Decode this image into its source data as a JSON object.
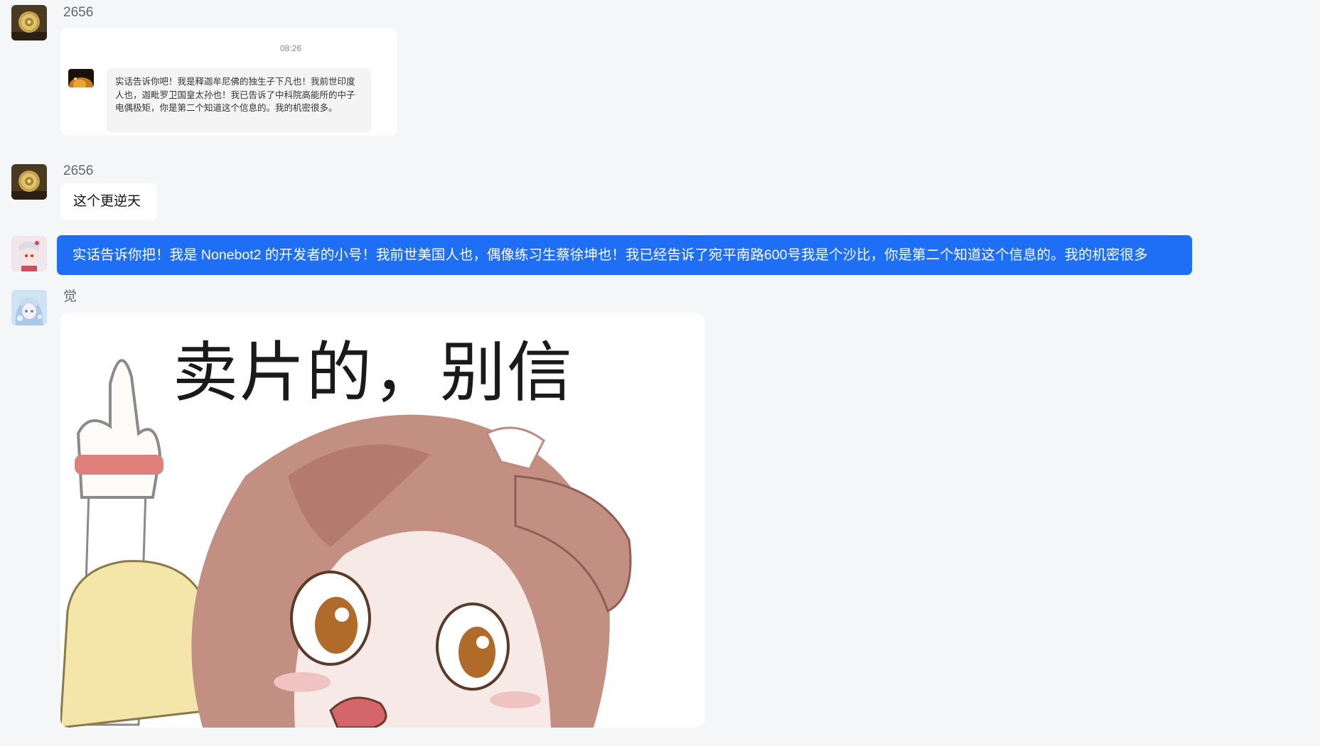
{
  "messages": [
    {
      "sender": "2656",
      "avatar_icon": "golden-coin-avatar-icon",
      "type": "forwarded-card",
      "forward": {
        "time": "08:26",
        "avatar_icon": "dark-orange-avatar-icon",
        "text": "实话告诉你吧！我是释迦牟尼佛的独生子下凡也！我前世印度人也，迦毗罗卫国皇太孙也！我已告诉了中科院高能所的中子电偶极矩，你是第二个知道这个信息的。我的机密很多。"
      }
    },
    {
      "sender": "2656",
      "avatar_icon": "golden-coin-avatar-icon",
      "type": "text",
      "text": "这个更逆天"
    },
    {
      "sender": "",
      "avatar_icon": "anime-girl-avatar-icon",
      "type": "self-text",
      "text": "实话告诉你把！我是 Nonebot2 的开发者的小号！我前世美国人也，偶像练习生蔡徐坤也！我已经告诉了宛平南路600号我是个沙比，你是第二个知道这个信息的。我的机密很多"
    },
    {
      "sender": "觉",
      "avatar_icon": "blue-anime-avatar-icon",
      "type": "image",
      "image": {
        "caption": "卖片的，别信",
        "icon": "anime-girl-middle-finger-meme-icon"
      }
    }
  ],
  "colors": {
    "background": "#f5f6f8",
    "self_bubble": "#1e6ff5",
    "card": "#ffffff"
  }
}
